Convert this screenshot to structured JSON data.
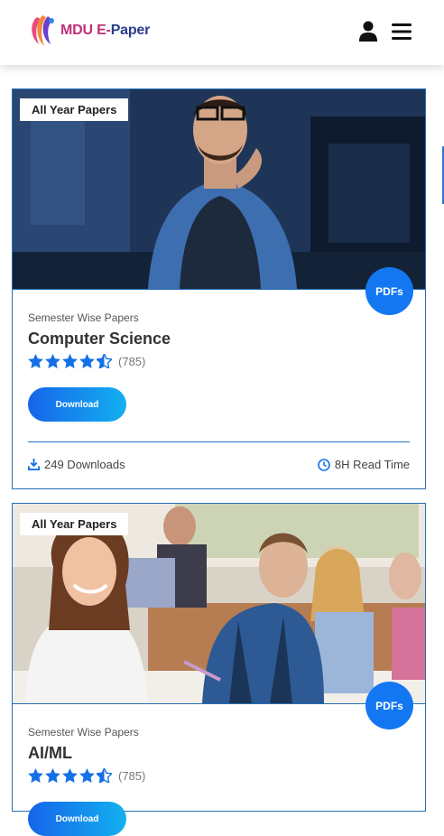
{
  "header": {
    "logo_text_part1": "MDU E-",
    "logo_text_part2": "Paper"
  },
  "cards": [
    {
      "tag": "All Year Papers",
      "badge": "PDFs",
      "subtitle": "Semester Wise Papers",
      "title": "Computer Science",
      "rating": 4.5,
      "rating_count": "(785)",
      "button": "Download",
      "downloads": "249 Downloads",
      "read_time": "8H Read Time"
    },
    {
      "tag": "All Year Papers",
      "badge": "PDFs",
      "subtitle": "Semester Wise Papers",
      "title": "AI/ML",
      "rating": 4.5,
      "rating_count": "(785)",
      "button": "Download"
    }
  ],
  "colors": {
    "accent": "#1477f2",
    "border": "#2570b8"
  }
}
